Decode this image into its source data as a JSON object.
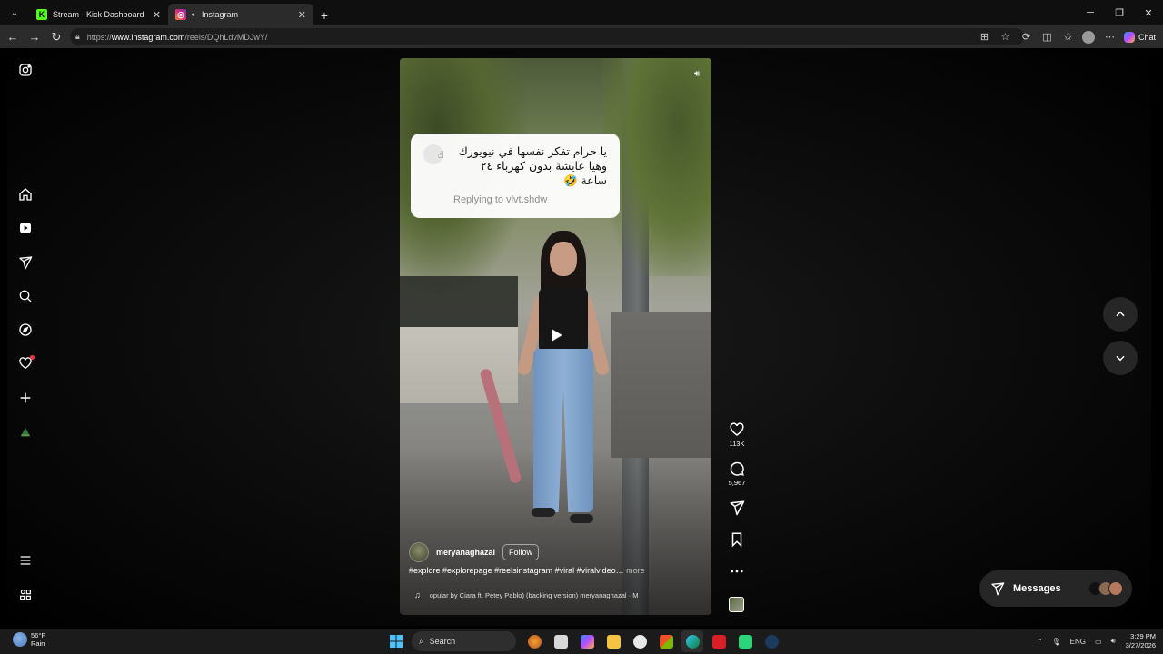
{
  "browser": {
    "tabs": [
      {
        "title": "Stream - Kick Dashboard",
        "favicon": "kick-icon",
        "active": false
      },
      {
        "title": "Instagram",
        "favicon": "instagram-icon",
        "active": true
      }
    ],
    "url_prefix": "https://",
    "url_host": "www.instagram.com",
    "url_path": "/reels/DQhLdvMDJwY/",
    "chat_label": "Chat"
  },
  "sidebar": {
    "items": [
      "instagram-logo",
      "home",
      "reels",
      "messages",
      "search",
      "explore",
      "notifications",
      "create",
      "profile",
      "more",
      "meta"
    ]
  },
  "reel": {
    "comment": {
      "line1": "يا حرام تفكر نفسها في نيويورك",
      "line2": "وهيا عايشة بدون كهرباء ٢٤",
      "line3": "ساعة 🤣",
      "replying_to": "Replying to vlvt.shdw"
    },
    "username": "meryanaghazal",
    "follow_label": "Follow",
    "caption": "#explore #explorepage #reelsinstagram #viral #viralvideo…",
    "caption_more": " more",
    "audio": "opular by Ciara ft. Petey Pablo) (backing version)   meryanaghazal · M",
    "likes": "113K",
    "comments": "5,967"
  },
  "messages_label": "Messages",
  "taskbar": {
    "weather_temp": "56°F",
    "weather_cond": "Rain",
    "search_label": "Search",
    "lang": "ENG",
    "time": "3:29 PM",
    "date": "3/27/2026"
  },
  "colors": {
    "notification_dot": "#ff3040",
    "kick_green": "#53fc18",
    "instagram_gradient_start": "#f58529",
    "instagram_gradient_end": "#dd2a7b"
  }
}
